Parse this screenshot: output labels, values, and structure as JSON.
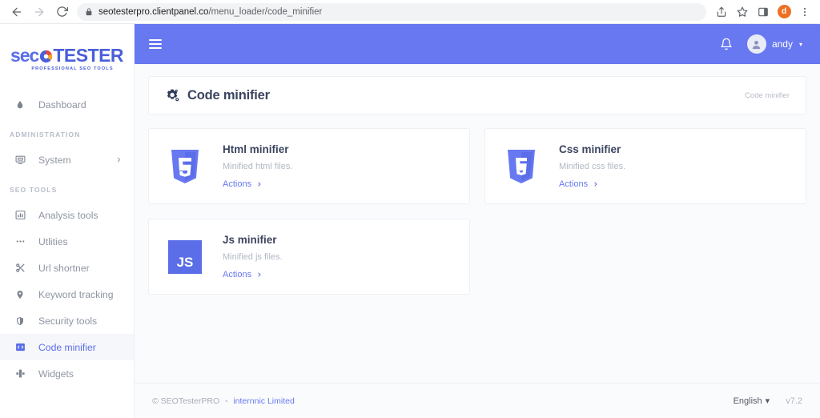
{
  "browser": {
    "back_icon": "back-arrow-icon",
    "forward_icon": "forward-arrow-icon",
    "reload_icon": "reload-icon",
    "lock_icon": "lock-icon",
    "url_domain": "seotesterpro.clientpanel.co",
    "url_path": "/menu_loader/code_minifier",
    "share_icon": "share-icon",
    "bookmark_icon": "bookmark-star-icon",
    "sidepanel_icon": "side-panel-icon",
    "profile_initial": "d",
    "menu_icon": "three-dot-menu-icon"
  },
  "sidebar": {
    "logo": {
      "seo": "sec",
      "tester": "TESTER",
      "tagline": "PROFESSIONAL SEO TOOLS"
    },
    "items": [
      {
        "label": "Dashboard",
        "icon": "droplet-icon",
        "active": false
      },
      {
        "label": "System",
        "icon": "monitor-icon",
        "active": false,
        "chevron": true
      }
    ],
    "sections": [
      {
        "label": "ADMINISTRATION"
      },
      {
        "label": "SEO TOOLS"
      }
    ],
    "tools": [
      {
        "label": "Analysis tools",
        "icon": "bar-chart-icon",
        "active": false
      },
      {
        "label": "Utlities",
        "icon": "ellipsis-icon",
        "active": false
      },
      {
        "label": "Url shortner",
        "icon": "scissors-icon",
        "active": false
      },
      {
        "label": "Keyword tracking",
        "icon": "map-pin-icon",
        "active": false
      },
      {
        "label": "Security tools",
        "icon": "shield-icon",
        "active": false
      },
      {
        "label": "Code minifier",
        "icon": "code-box-icon",
        "active": true
      },
      {
        "label": "Widgets",
        "icon": "widgets-icon",
        "active": false
      }
    ]
  },
  "topbar": {
    "menu_toggle_icon": "hamburger-icon",
    "notification_icon": "bell-icon",
    "user_name": "andy",
    "user_caret": "▾",
    "bg_color": "#6778f0"
  },
  "header": {
    "icon": "cogs-icon",
    "title": "Code minifier",
    "breadcrumb": "Code minifier"
  },
  "cards": [
    {
      "title": "Html minifier",
      "desc": "Minified html files.",
      "action": "Actions",
      "icon": "html5-shield-icon",
      "icon_letter": "5",
      "icon_color": "#6778f0"
    },
    {
      "title": "Css minifier",
      "desc": "Minified css files.",
      "action": "Actions",
      "icon": "css3-shield-icon",
      "icon_letter": "3",
      "icon_color": "#6778f0"
    },
    {
      "title": "Js minifier",
      "desc": "Minified js files.",
      "action": "Actions",
      "icon": "javascript-square-icon",
      "icon_letter": "JS",
      "icon_color": "#5b6ee8"
    }
  ],
  "footer": {
    "copyright": "© SEOTesterPRO",
    "separator": "•",
    "company": "internnic Limited",
    "language": "English",
    "language_caret": "▾",
    "version": "v7.2"
  },
  "colors": {
    "accent": "#6778f0",
    "content_bg": "#fafbfc",
    "card_border": "#edeff3"
  }
}
